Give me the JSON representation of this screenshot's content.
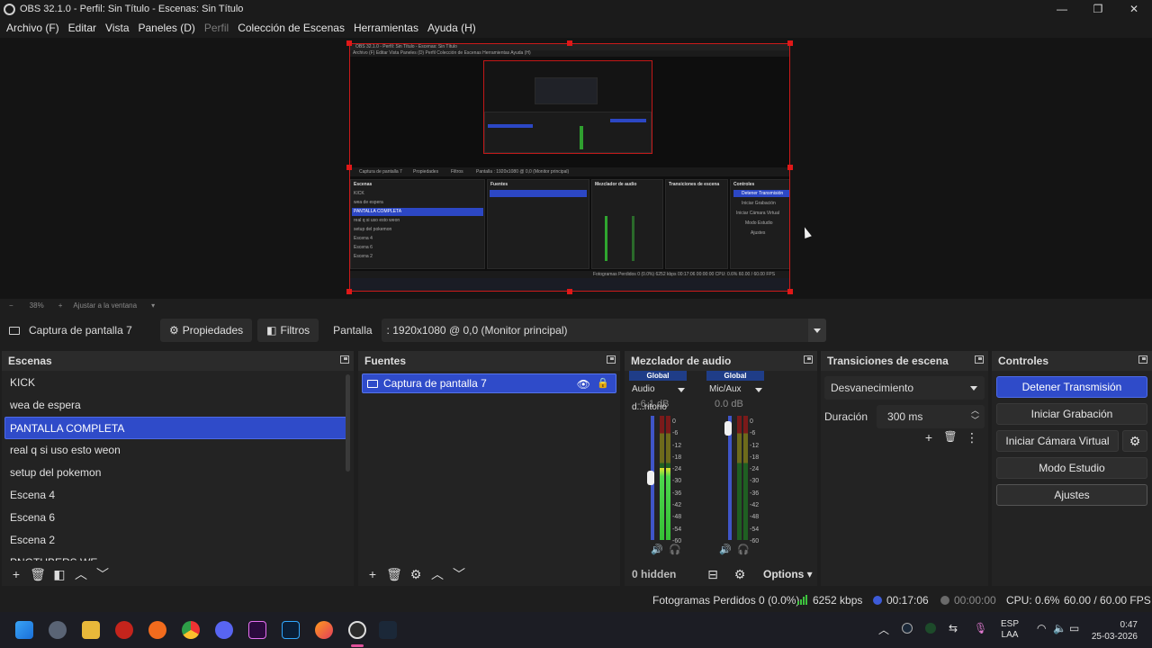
{
  "window": {
    "title": "OBS 32.1.0 - Perfil: Sin Título - Escenas: Sin Título",
    "minimize": "—",
    "maximize": "❐",
    "close": "✕"
  },
  "menu": [
    "Archivo (F)",
    "Editar",
    "Vista",
    "Paneles (D)",
    "Perfil",
    "Colección de Escenas",
    "Herramientas",
    "Ayuda (H)"
  ],
  "zoom": {
    "minus": "−",
    "level": "38%",
    "plus": "+",
    "fit": "Ajustar a la ventana"
  },
  "source_bar": {
    "source_name": "Captura de pantalla 7",
    "properties": "Propiedades",
    "filters": "Filtros",
    "display_label": "Pantalla",
    "display_value": ": 1920x1080 @ 0,0 (Monitor principal)"
  },
  "scenes": {
    "title": "Escenas",
    "items": [
      "KICK",
      "wea de espera",
      "PANTALLA COMPLETA",
      "real q si uso esto weon",
      "setup del pokemon",
      "Escena 4",
      "Escena 6",
      "Escena 2",
      "PNGTUBERS WE"
    ],
    "selected_index": 2
  },
  "sources": {
    "title": "Fuentes",
    "items": [
      "Captura de pantalla 7"
    ]
  },
  "mixer": {
    "title": "Mezclador de audio",
    "channels": [
      {
        "global": "Global",
        "name": "Audio d...ritorio",
        "db": "-6.1 dB",
        "fader_level": 0.5,
        "meter_active": true
      },
      {
        "global": "Global",
        "name": "Mic/Aux",
        "db": "0.0 dB",
        "fader_level": 0.95,
        "meter_active": false
      }
    ],
    "scale": [
      "0",
      "-6",
      "-12",
      "-18",
      "-24",
      "-30",
      "-36",
      "-42",
      "-48",
      "-54",
      "-60"
    ],
    "hidden": "0 hidden",
    "options": "Options"
  },
  "transitions": {
    "title": "Transiciones de escena",
    "selected": "Desvanecimiento",
    "duration_label": "Duración",
    "duration_value": "300 ms"
  },
  "controls": {
    "title": "Controles",
    "stop_stream": "Detener Transmisión",
    "start_recording": "Iniciar Grabación",
    "virtual_cam": "Iniciar Cámara Virtual",
    "studio_mode": "Modo Estudio",
    "settings": "Ajustes"
  },
  "status": {
    "dropped": "Fotogramas Perdidos 0 (0.0%)",
    "bitrate": "6252 kbps",
    "stream_time": "00:17:06",
    "rec_time": "00:00:00",
    "cpu": "CPU: 0.6%",
    "fps": "60.00 / 60.00 FPS"
  },
  "taskbar": {
    "lang_top": "ESP",
    "lang_bottom": "LAA",
    "time": "0:47",
    "date": "25-03-2026"
  },
  "preview_text": {
    "title": "OBS 32.1.0 - Perfil: Sin Título - Escenas: Sin Título",
    "menu": "Archivo (F)   Editar   Vista   Paneles (D)   Perfil   Colección de Escenas   Herramientas   Ayuda (H)",
    "source": "Captura de pantalla 7",
    "props": "Propiedades",
    "filters": "Filtros",
    "display": "Pantalla     : 1920x1080 @ 0,0 (Monitor principal)",
    "scenes_title": "Escenas",
    "scene_items": [
      "KICK",
      "wea de espera",
      "PANTALLA COMPLETA",
      "real q si uso esto weon",
      "setup del pokemon",
      "Escena 4",
      "Escena 6",
      "Escena 2"
    ],
    "sources_title": "Fuentes",
    "mixer_title": "Mezclador de audio",
    "trans_title": "Transiciones de escena",
    "ctrl_title": "Controles",
    "ctrl_buttons": [
      "Detener Transmisión",
      "Iniciar Grabación",
      "Iniciar Cámara Virtual",
      "Modo Estudio",
      "Ajustes"
    ],
    "status": "Fotogramas Perdidos 0 (0.0%)   6252 kbps   00:17:06   00:00:00   CPU: 0.6%   60.00 / 60.00 FPS"
  },
  "colors": {
    "accent": "#2f4bc9",
    "selection_border": "#e01818",
    "stream_ok": "#3ec43e"
  }
}
